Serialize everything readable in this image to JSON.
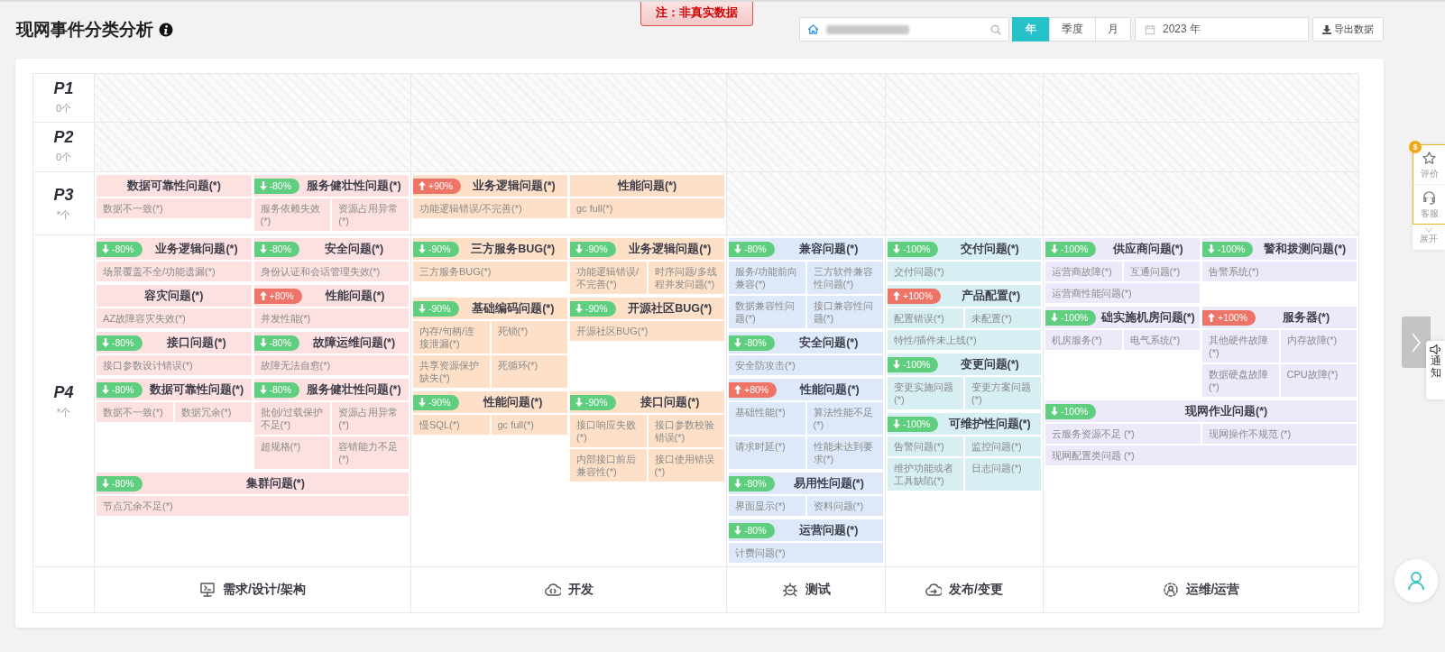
{
  "header": {
    "title": "现网事件分类分析",
    "notice": "注：非真实数据",
    "period_tabs": [
      {
        "label": "年",
        "selected": true
      },
      {
        "label": "季度",
        "selected": false
      },
      {
        "label": "月",
        "selected": false
      }
    ],
    "date": "2023 年",
    "export_button": "导出数据"
  },
  "stages": [
    {
      "label": "需求/设计/架构",
      "color": "#fde1e1"
    },
    {
      "label": "开发",
      "color": "#fde0c7"
    },
    {
      "label": "测试",
      "color": "#dde9f9"
    },
    {
      "label": "发布/变更",
      "color": "#d7eff2"
    },
    {
      "label": "运维/运营",
      "color": "#ece9fb"
    }
  ],
  "priorities": [
    {
      "label": "P1",
      "count": "0个",
      "cells": [
        {
          "kind": "empty"
        },
        {
          "kind": "empty"
        },
        {
          "kind": "empty"
        },
        {
          "kind": "empty"
        },
        {
          "kind": "empty"
        }
      ]
    },
    {
      "label": "P2",
      "count": "0个",
      "cells": [
        {
          "kind": "empty"
        },
        {
          "kind": "empty"
        },
        {
          "kind": "empty"
        },
        {
          "kind": "empty"
        },
        {
          "kind": "empty"
        }
      ]
    },
    {
      "label": "P3",
      "count": "*个",
      "cells": [
        {
          "kind": "cards",
          "cards": [
            {
              "title": "数据可靠性问题(*)",
              "wide": false,
              "items": [
                "数据不一致(*)"
              ]
            },
            {
              "badge": {
                "text": "-80%",
                "rising": false
              },
              "title": "服务健壮性问题(*)",
              "wide": false,
              "items": [
                "服务依赖失效(*)",
                "资源占用异常(*)"
              ]
            }
          ]
        },
        {
          "kind": "cards",
          "cards": [
            {
              "badge": {
                "text": "+90%",
                "rising": true
              },
              "title": "业务逻辑问题(*)",
              "wide": false,
              "items": [
                "功能逻辑错误/不完善(*)"
              ]
            },
            {
              "title": "性能问题(*)",
              "wide": false,
              "items": [
                "gc full(*)"
              ]
            }
          ]
        },
        {
          "kind": "empty"
        },
        {
          "kind": "empty"
        },
        {
          "kind": "empty"
        }
      ]
    },
    {
      "label": "P4",
      "count": "*个",
      "cells": [
        {
          "kind": "cards",
          "cards": [
            {
              "badge": {
                "text": "-80%",
                "rising": false
              },
              "title": "业务逻辑问题(*)",
              "wide": false,
              "items": [
                "场景覆盖不全/功能遗漏(*)"
              ]
            },
            {
              "badge": {
                "text": "-80%",
                "rising": false
              },
              "title": "安全问题(*)",
              "wide": false,
              "items": [
                "身份认证和会话管理失效(*)"
              ]
            },
            {
              "title": "容灾问题(*)",
              "wide": false,
              "items": [
                "AZ故障容灾失效(*)"
              ]
            },
            {
              "badge": {
                "text": "+80%",
                "rising": true
              },
              "title": "性能问题(*)",
              "wide": false,
              "items": [
                "并发性能(*)"
              ]
            },
            {
              "badge": {
                "text": "-80%",
                "rising": false
              },
              "title": "接口问题(*)",
              "wide": false,
              "items": [
                "接口参数设计错误(*)"
              ]
            },
            {
              "badge": {
                "text": "-80%",
                "rising": false
              },
              "title": "故障运维问题(*)",
              "wide": false,
              "items": [
                "故障无法自愈(*)"
              ]
            },
            {
              "badge": {
                "text": "-80%",
                "rising": false
              },
              "title": "数据可靠性问题(*)",
              "wide": false,
              "items": [
                "数据不一致(*)",
                "数据冗余(*)"
              ]
            },
            {
              "badge": {
                "text": "-80%",
                "rising": false
              },
              "title": "服务健壮性问题(*)",
              "wide": false,
              "items": [
                "批创/过载保护不足(*)",
                "资源占用异常(*)",
                "超规格(*)",
                "容错能力不足(*)"
              ]
            },
            {
              "badge": {
                "text": "-80%",
                "rising": false
              },
              "title": "集群问题(*)",
              "wide": true,
              "items": [
                "节点冗余不足(*)"
              ]
            }
          ]
        },
        {
          "kind": "cards",
          "cards": [
            {
              "badge": {
                "text": "-90%",
                "rising": false
              },
              "title": "三方服务BUG(*)",
              "wide": false,
              "items": [
                "三方服务BUG(*)"
              ]
            },
            {
              "badge": {
                "text": "-90%",
                "rising": false
              },
              "title": "业务逻辑问题(*)",
              "wide": false,
              "items": [
                "功能逻辑错误/不完善(*)",
                "时序问题/多线程并发问题(*)"
              ]
            },
            {
              "badge": {
                "text": "-90%",
                "rising": false
              },
              "title": "基础编码问题(*)",
              "wide": false,
              "items": [
                "内存/句柄/连接泄漏(*)",
                "死锁(*)",
                "共享资源保护缺失(*)",
                "死循环(*)"
              ]
            },
            {
              "badge": {
                "text": "-90%",
                "rising": false
              },
              "title": "开源社区BUG(*)",
              "wide": false,
              "items": [
                "开源社区BUG(*)"
              ]
            },
            {
              "badge": {
                "text": "-90%",
                "rising": false
              },
              "title": "性能问题(*)",
              "wide": false,
              "items": [
                "慢SQL(*)",
                "gc full(*)"
              ]
            },
            {
              "badge": {
                "text": "-90%",
                "rising": false
              },
              "title": "接口问题(*)",
              "wide": false,
              "items": [
                "接口响应失败(*)",
                "接口参数校验错误(*)",
                "内部接口前后兼容性(*)",
                "接口使用错误(*)"
              ]
            }
          ]
        },
        {
          "kind": "cards",
          "cards": [
            {
              "badge": {
                "text": "-80%",
                "rising": false
              },
              "title": "兼容问题(*)",
              "items": [
                "服务/功能前向兼容(*)",
                "三方软件兼容性问题(*)",
                "数据兼容性问题(*)",
                "接口兼容性问题(*)"
              ]
            },
            {
              "badge": {
                "text": "-80%",
                "rising": false
              },
              "title": "安全问题(*)",
              "items": [
                "安全防攻击(*)"
              ]
            },
            {
              "badge": {
                "text": "+80%",
                "rising": true
              },
              "title": "性能问题(*)",
              "items": [
                "基础性能(*)",
                "算法性能不足(*)",
                "请求时延(*)",
                "性能未达到要求(*)"
              ]
            },
            {
              "badge": {
                "text": "-80%",
                "rising": false
              },
              "title": "易用性问题(*)",
              "items": [
                "界面显示(*)",
                "资料问题(*)"
              ]
            },
            {
              "badge": {
                "text": "-80%",
                "rising": false
              },
              "title": "运营问题(*)",
              "items": [
                "计费问题(*)"
              ]
            }
          ]
        },
        {
          "kind": "cards",
          "cards": [
            {
              "badge": {
                "text": "-100%",
                "rising": false
              },
              "title": "交付问题(*)",
              "items": [
                "交付问题(*)"
              ]
            },
            {
              "badge": {
                "text": "+100%",
                "rising": true
              },
              "title": "产品配置(*)",
              "items": [
                "配置错误(*)",
                "未配置(*)",
                "特性/插件未上线(*)"
              ]
            },
            {
              "badge": {
                "text": "-100%",
                "rising": false
              },
              "title": "变更问题(*)",
              "items": [
                "变更实施问题(*)",
                "变更方案问题(*)"
              ]
            },
            {
              "badge": {
                "text": "-100%",
                "rising": false
              },
              "title": "可维护性问题(*)",
              "items": [
                "告警问题(*)",
                "监控问题(*)",
                "维护功能或者工具缺陷(*)",
                "日志问题(*)"
              ]
            }
          ]
        },
        {
          "kind": "cards",
          "cards": [
            {
              "badge": {
                "text": "-100%",
                "rising": false
              },
              "title": "供应商问题(*)",
              "wide": false,
              "items": [
                "运营商故障(*)",
                "互通问题(*)",
                "运营商性能问题(*)"
              ]
            },
            {
              "badge": {
                "text": "-100%",
                "rising": false
              },
              "title": "警和拨测问题(*)",
              "wide": false,
              "items": [
                "告警系统(*)"
              ]
            },
            {
              "badge": {
                "text": "-100%",
                "rising": false
              },
              "title": "础实施机房问题(*)",
              "wide": false,
              "items": [
                "机房服务(*)",
                "电气系统(*)"
              ]
            },
            {
              "badge": {
                "text": "+100%",
                "rising": true
              },
              "title": "服务器(*)",
              "wide": false,
              "items": [
                "其他硬件故障(*)",
                "内存故障(*)",
                "数据硬盘故障(*)",
                "CPU故障(*)"
              ]
            },
            {
              "badge": {
                "text": "-100%",
                "rising": false
              },
              "title": "现网作业问题(*)",
              "wide": true,
              "items": [
                "云服务资源不足 (*)",
                "现网操作不规范 (*)",
                "现网配置类问题 (*)"
              ]
            }
          ]
        }
      ]
    }
  ],
  "side_panel": {
    "coin_badge": "$",
    "buttons": [
      "评价",
      "客服"
    ],
    "expand": "展开"
  },
  "notice_tab": "通知"
}
